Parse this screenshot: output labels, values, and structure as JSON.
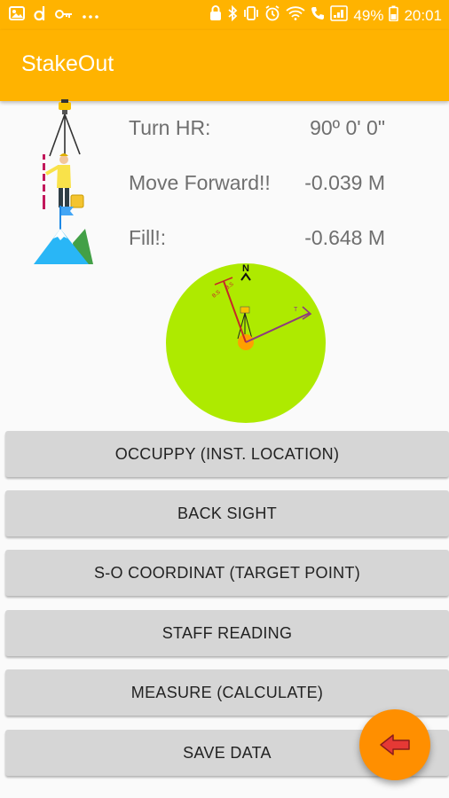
{
  "status_bar": {
    "battery_percent": "49%",
    "time": "20:01",
    "left_icons": [
      "image-icon",
      "d-app-icon",
      "key-icon",
      "more-icon"
    ],
    "right_icons": [
      "lock-icon",
      "bluetooth-icon",
      "vibrate-icon",
      "alarm-icon",
      "wifi-icon",
      "call-icon",
      "signal-icon",
      "battery-icon"
    ]
  },
  "app_bar": {
    "title": "StakeOut"
  },
  "info": {
    "turn_label": "Turn HR:",
    "turn_value": "90º 0' 0\"",
    "move_label": "Move Forward!!",
    "move_value": "-0.039 M",
    "fill_label": "Fill!:",
    "fill_value": "-0.648 M"
  },
  "compass": {
    "north_label": "N",
    "back_label": "B.S",
    "target_label": "T",
    "colors": {
      "disc": "#aeea00",
      "instrument": "#ffa000",
      "back_line": "#c62828",
      "target_line": "#8e3a7e"
    }
  },
  "buttons": {
    "occupy": "OCCUPPY (INST. LOCATION)",
    "back_sight": "BACK SIGHT",
    "so_coordinate": "S-O COORDINAT (TARGET POINT)",
    "staff_reading": "STAFF READING",
    "measure": "MEASURE (CALCULATE)",
    "save_data": "SAVE DATA"
  },
  "fab": {
    "icon": "arrow-left-icon",
    "color": "#ff8f00",
    "arrow_color": "#e53935"
  },
  "colors": {
    "accent": "#ffb300",
    "button_bg": "#d6d6d6",
    "text_gray": "#6f6f6f"
  }
}
